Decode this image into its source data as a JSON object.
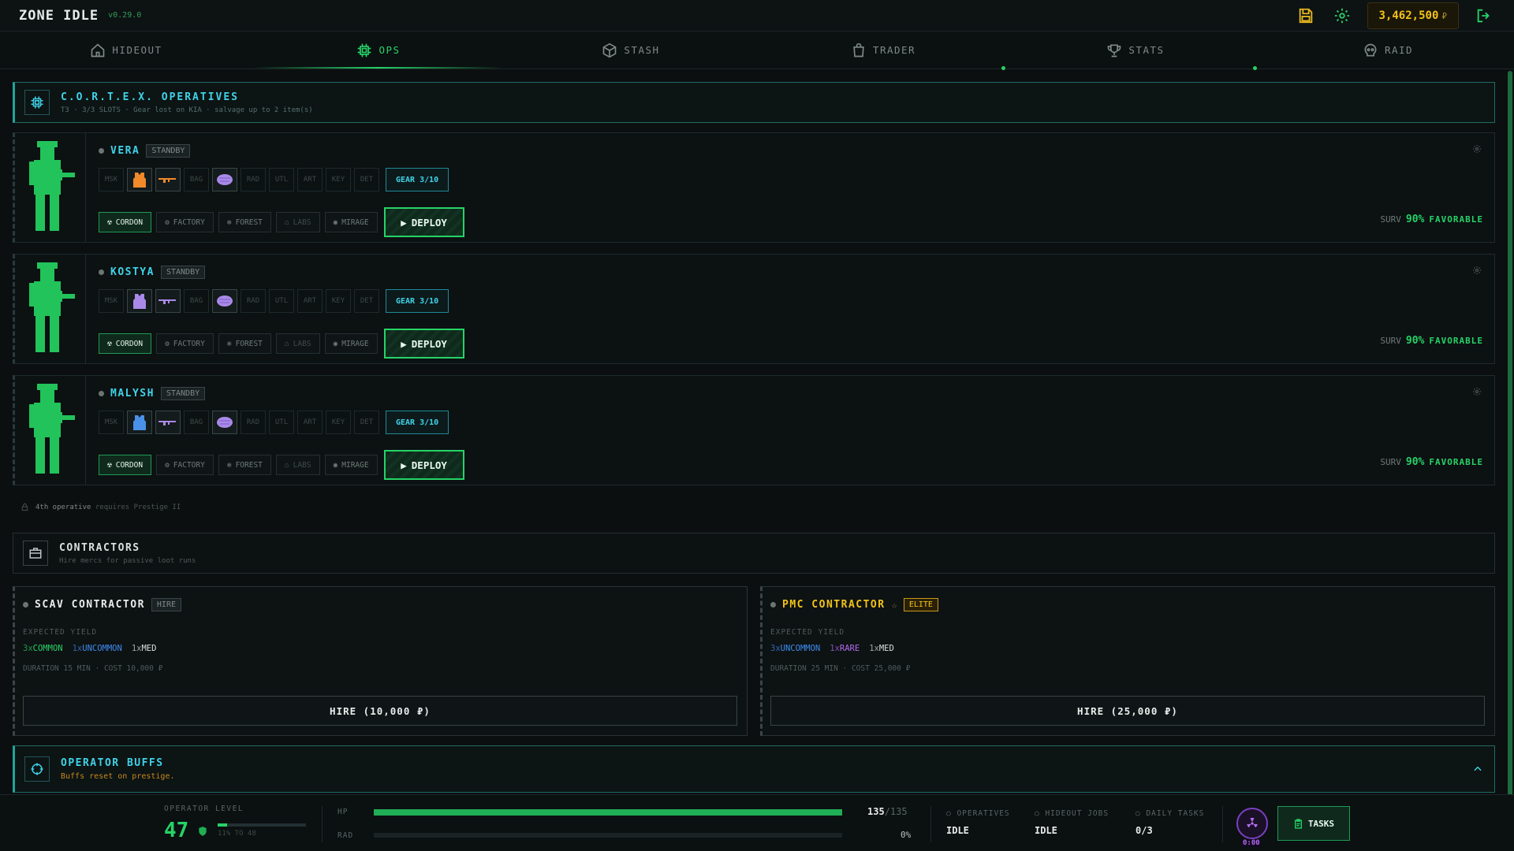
{
  "topbar": {
    "title": "ZONE IDLE",
    "version": "v0.29.0",
    "money": "3,462,500",
    "currency": "₽"
  },
  "nav": [
    {
      "label": "HIDEOUT",
      "icon": "home-icon"
    },
    {
      "label": "OPS",
      "icon": "chip-icon",
      "active": true
    },
    {
      "label": "STASH",
      "icon": "cube-icon"
    },
    {
      "label": "TRADER",
      "icon": "bag-icon"
    },
    {
      "label": "STATS",
      "icon": "trophy-icon"
    },
    {
      "label": "RAID",
      "icon": "skull-icon"
    }
  ],
  "operatives_section": {
    "title": "C.O.R.T.E.X. OPERATIVES",
    "subtitle": "T3 · 3/3 SLOTS · Gear lost on KIA · salvage up to 2 item(s)"
  },
  "slot_labels": [
    "MSK",
    "BAG",
    "RAD",
    "UTL",
    "ART",
    "KEY",
    "DET"
  ],
  "zones": [
    "CORDON",
    "FACTORY",
    "FOREST",
    "LABS",
    "MIRAGE"
  ],
  "operatives": [
    {
      "name": "VERA",
      "status": "STANDBY",
      "gear": "GEAR 3/10",
      "deploy": "DEPLOY",
      "surv_label": "SURV",
      "surv_pct": "90%",
      "surv_text": "FAVORABLE",
      "armor_color": "#f08a2a",
      "weapon_color": "#f08a2a"
    },
    {
      "name": "KOSTYA",
      "status": "STANDBY",
      "gear": "GEAR 3/10",
      "deploy": "DEPLOY",
      "surv_label": "SURV",
      "surv_pct": "90%",
      "surv_text": "FAVORABLE",
      "armor_color": "#a98ae8",
      "weapon_color": "#a98ae8"
    },
    {
      "name": "MALYSH",
      "status": "STANDBY",
      "gear": "GEAR 3/10",
      "deploy": "DEPLOY",
      "surv_label": "SURV",
      "surv_pct": "90%",
      "surv_text": "FAVORABLE",
      "armor_color": "#4a90e8",
      "weapon_color": "#a98ae8"
    }
  ],
  "prestige_note": {
    "bold": "4th operative",
    "rest": "requires Prestige II"
  },
  "contractors": {
    "title": "CONTRACTORS",
    "subtitle": "Hire mercs for passive loot runs"
  },
  "contracts": [
    {
      "title": "SCAV CONTRACTOR",
      "badge": "HIRE",
      "yield_label": "EXPECTED YIELD",
      "yield": [
        {
          "qty": "3x",
          "name": "COMMON",
          "cls": "c-common"
        },
        {
          "qty": "1x",
          "name": "UNCOMMON",
          "cls": "c-uncommon"
        },
        {
          "qty": "1x",
          "name": "MED",
          "cls": "c-med"
        }
      ],
      "duration": "DURATION 15 MIN · COST 10,000 ₽",
      "hire": "HIRE (10,000 ₽)"
    },
    {
      "title": "PMC CONTRACTOR",
      "badge": "ELITE",
      "yield_label": "EXPECTED YIELD",
      "yield": [
        {
          "qty": "3x",
          "name": "UNCOMMON",
          "cls": "c-uncommon"
        },
        {
          "qty": "1x",
          "name": "RARE",
          "cls": "c-rare"
        },
        {
          "qty": "1x",
          "name": "MED",
          "cls": "c-med"
        }
      ],
      "duration": "DURATION 25 MIN · COST 25,000 ₽",
      "hire": "HIRE (25,000 ₽)"
    }
  ],
  "buffs": {
    "title": "OPERATOR BUFFS",
    "subtitle": "Buffs reset on prestige."
  },
  "bottom": {
    "level_label": "OPERATOR LEVEL",
    "level": "47",
    "level_progress": 0.11,
    "level_sub": "11% TO 48",
    "hp_label": "HP",
    "hp_value": "135",
    "hp_max": "/135",
    "hp_fraction": 1.0,
    "rad_label": "RAD",
    "rad_value": "0%",
    "rad_fraction": 0.0,
    "operatives_label": "OPERATIVES",
    "operatives_value": "IDLE",
    "hideout_label": "HIDEOUT JOBS",
    "hideout_value": "IDLE",
    "daily_label": "DAILY TASKS",
    "daily_value": "0/3",
    "timer": "0:00",
    "tasks_label": "TASKS"
  }
}
